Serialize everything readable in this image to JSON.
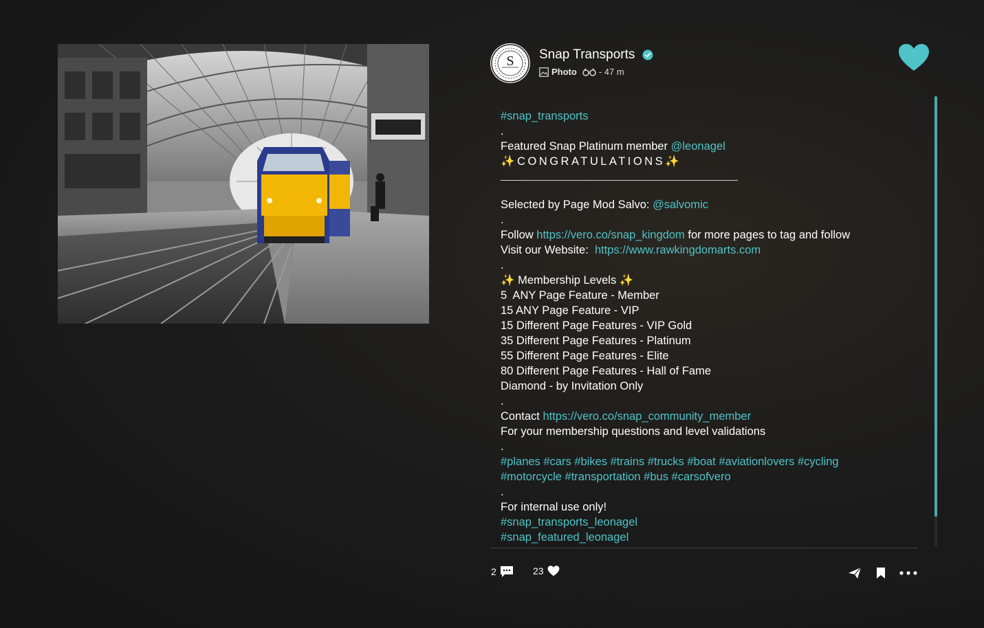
{
  "post": {
    "account_name": "Snap Transports",
    "avatar_text": "S",
    "type_label": "Photo",
    "time_ago": "- 47 m"
  },
  "caption": {
    "hashtag_top": "#snap_transports",
    "dot1": ".",
    "featured_prefix": "Featured Snap Platinum member ",
    "featured_handle": "@leonagel",
    "congrats": "✨CONGRATULATIONS✨",
    "selected_prefix": "Selected by Page Mod Salvo: ",
    "selected_handle": "@salvomic",
    "dot2": ".",
    "follow_prefix": "Follow ",
    "follow_link": "https://vero.co/snap_kingdom",
    "follow_suffix": " for more pages to tag and follow",
    "visit_prefix": "Visit our Website:  ",
    "visit_link": "https://www.rawkingdomarts.com",
    "dot3": ".",
    "levels_title": "✨ Membership Levels ✨",
    "levels": [
      "5  ANY Page Feature - Member",
      "15 ANY Page Feature - VIP",
      "15 Different Page Features - VIP Gold",
      "35 Different Page Features - Platinum",
      "55 Different Page Features - Elite",
      "80 Different Page Features - Hall of Fame",
      "Diamond - by Invitation Only"
    ],
    "dot4": ".",
    "contact_prefix": "Contact ",
    "contact_link": "https://vero.co/snap_community_member",
    "contact_note": "For your membership questions and level validations",
    "dot5": ".",
    "tags_line1": "#planes #cars #bikes #trains #trucks #boat #aviationlovers #cycling",
    "tags_line2": "#motorcycle #transportation #bus #carsofvero",
    "dot6": ".",
    "internal_label": "For internal use only!",
    "internal_tag1": "#snap_transports_leonagel",
    "internal_tag2": "#snap_featured_leonagel"
  },
  "footer": {
    "comment_count": "2",
    "like_count": "23"
  },
  "colors": {
    "accent": "#4fc3c7",
    "background": "#1c1c1c",
    "train_yellow": "#f2b705",
    "train_blue": "#2b3a8c"
  },
  "icons": {
    "verified": "verified-badge-icon",
    "photo": "image-icon",
    "visibility": "binoculars-icon",
    "like_big": "heart-icon",
    "comment": "comment-bubble-icon",
    "like_small": "heart-icon",
    "share": "send-icon",
    "bookmark": "bookmark-icon",
    "more": "more-dots-icon"
  }
}
